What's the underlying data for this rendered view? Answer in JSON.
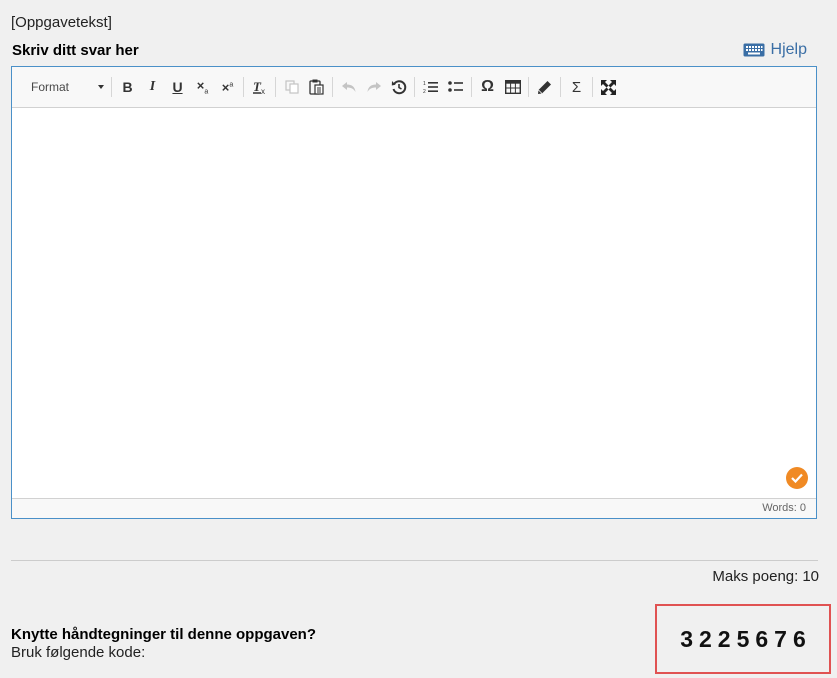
{
  "task": {
    "text": "[Oppgavetekst]"
  },
  "answer": {
    "label": "Skriv ditt svar her",
    "help_label": "Hjelp"
  },
  "toolbar": {
    "format_label": "Format",
    "buttons": [
      {
        "name": "bold-button",
        "icon": "B"
      },
      {
        "name": "italic-button",
        "icon": "I"
      },
      {
        "name": "underline-button",
        "icon": "U"
      },
      {
        "name": "subscript-button",
        "icon": "x₂"
      },
      {
        "name": "superscript-button",
        "icon": "x²"
      },
      {
        "name": "clear-formatting-button",
        "icon": "Tx"
      },
      {
        "name": "copy-button",
        "icon": "copy"
      },
      {
        "name": "paste-button",
        "icon": "paste"
      },
      {
        "name": "undo-button",
        "icon": "undo"
      },
      {
        "name": "redo-button",
        "icon": "redo"
      },
      {
        "name": "restore-button",
        "icon": "history"
      },
      {
        "name": "numbered-list-button",
        "icon": "ordered-list"
      },
      {
        "name": "bullet-list-button",
        "icon": "bullet-list"
      },
      {
        "name": "special-char-button",
        "icon": "Ω"
      },
      {
        "name": "table-button",
        "icon": "table"
      },
      {
        "name": "draw-button",
        "icon": "pencil"
      },
      {
        "name": "formula-button",
        "icon": "Σ"
      },
      {
        "name": "fullscreen-button",
        "icon": "expand"
      }
    ]
  },
  "editor": {
    "word_count": "Words: 0",
    "accent_color": "#4a90c8",
    "spellcheck_color": "#f08a24"
  },
  "scoring": {
    "label": "Maks poeng:",
    "value": "10"
  },
  "drawing": {
    "title": "Knytte håndtegninger til denne oppgaven?",
    "subtitle": "Bruk følgende kode:",
    "code": "3225676",
    "highlight_color": "#e05252"
  }
}
